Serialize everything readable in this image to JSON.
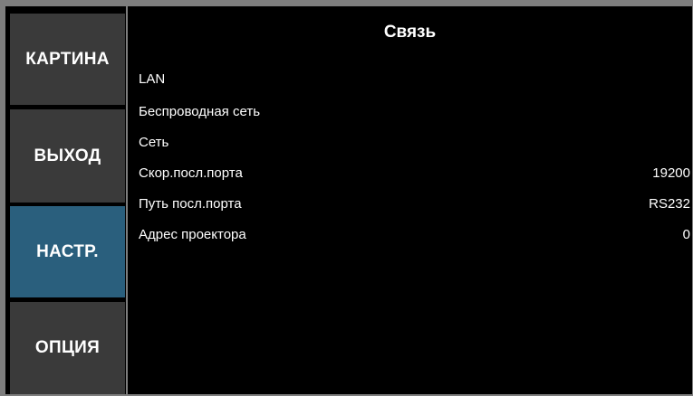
{
  "sidebar": {
    "items": [
      {
        "label": "КАРТИНА"
      },
      {
        "label": "ВЫХОД"
      },
      {
        "label": "НАСТР."
      },
      {
        "label": "ОПЦИЯ"
      }
    ]
  },
  "panel": {
    "title": "Связь",
    "rows": [
      {
        "label": "LAN",
        "value": ""
      },
      {
        "label": "Беспроводная сеть",
        "value": ""
      },
      {
        "label": "Сеть",
        "value": ""
      },
      {
        "label": "Скор.посл.порта",
        "value": "19200"
      },
      {
        "label": "Путь посл.порта",
        "value": "RS232"
      },
      {
        "label": "Адрес проектора",
        "value": "0"
      }
    ]
  },
  "colors": {
    "background": "#000000",
    "button": "#3a3a3a",
    "button_active": "#2a5f7d",
    "text": "#ffffff"
  }
}
